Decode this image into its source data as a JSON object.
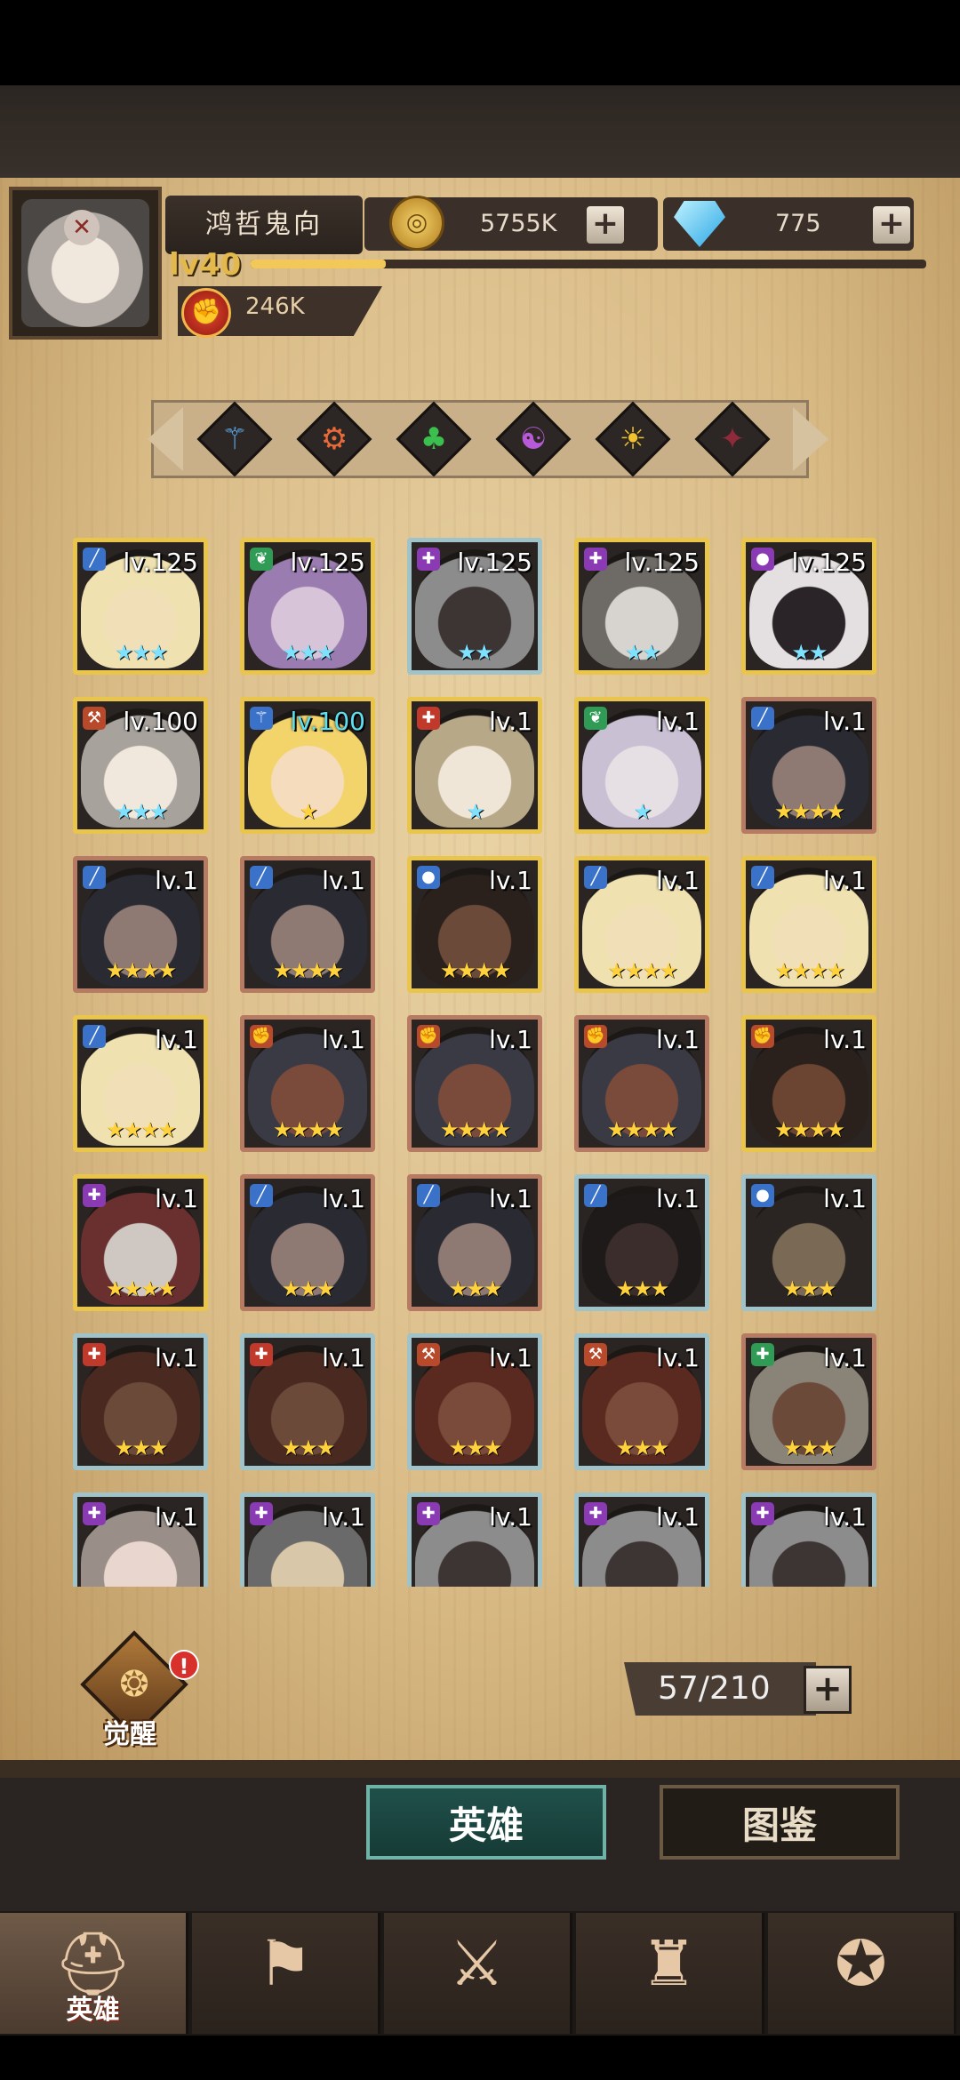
{
  "player": {
    "name": "鸿哲鬼向",
    "level_label": "lv40",
    "xp_fraction": 0.2,
    "power": "246K"
  },
  "currency": {
    "gold": "5755K",
    "gems": "775",
    "plus_symbol": "+"
  },
  "filters": [
    {
      "icon": "staff-class-icon",
      "glyph": "⚚",
      "color": "#5aa7e6"
    },
    {
      "icon": "gear-class-icon",
      "glyph": "⚙",
      "color": "#e86a3a"
    },
    {
      "icon": "clover-class-icon",
      "glyph": "♣",
      "color": "#3bbf4e"
    },
    {
      "icon": "orb-class-icon",
      "glyph": "☯",
      "color": "#b75ad8"
    },
    {
      "icon": "sun-class-icon",
      "glyph": "☀",
      "color": "#f1c12f"
    },
    {
      "icon": "demon-class-icon",
      "glyph": "✦",
      "color": "#8f2a3a"
    }
  ],
  "heroes": [
    {
      "level": "lv.125",
      "stars": "★★★",
      "star_color": "blue",
      "frame": "gold",
      "class": "blade",
      "class_color": "#3a72c9",
      "skin": "#f1dfb8",
      "hair": "#efe2b0"
    },
    {
      "level": "lv.125",
      "stars": "★★★",
      "star_color": "blue",
      "frame": "gold",
      "class": "herb",
      "class_color": "#2f9b55",
      "skin": "#d8c4d8",
      "hair": "#9a7cb0"
    },
    {
      "level": "lv.125",
      "stars": "★★",
      "star_color": "blue",
      "frame": "blue",
      "class": "holy",
      "class_color": "#8a3ab3",
      "skin": "#3c3533",
      "hair": "#8d8c8d"
    },
    {
      "level": "lv.125",
      "stars": "★★",
      "star_color": "blue",
      "frame": "gold",
      "class": "holy",
      "class_color": "#8a3ab3",
      "skin": "#d7d3cf",
      "hair": "#6e6a66"
    },
    {
      "level": "lv.125",
      "stars": "★★",
      "star_color": "blue",
      "frame": "gold",
      "class": "orb",
      "class_color": "#8a3ab3",
      "skin": "#2a2327",
      "hair": "#e4dfe0"
    },
    {
      "level": "lv.100",
      "stars": "★★★",
      "star_color": "blue",
      "frame": "gold",
      "class": "axe",
      "class_color": "#b84a2b",
      "skin": "#f0e7dd",
      "hair": "#a8a29c"
    },
    {
      "level": "lv.100",
      "level_color": "cyan",
      "stars": "★",
      "star_color": "gold",
      "frame": "gold",
      "class": "staff",
      "class_color": "#3a72c9",
      "skin": "#f4dcbc",
      "hair": "#f2d46a"
    },
    {
      "level": "lv.1",
      "stars": "★",
      "star_color": "blue",
      "frame": "gold",
      "class": "heal",
      "class_color": "#c0392b",
      "skin": "#efe6d8",
      "hair": "#b7a888"
    },
    {
      "level": "lv.1",
      "stars": "★",
      "star_color": "blue",
      "frame": "gold",
      "class": "herb",
      "class_color": "#2f9b55",
      "skin": "#e6e0e4",
      "hair": "#c9c0d4"
    },
    {
      "level": "lv.1",
      "stars": "★★★★",
      "star_color": "gold",
      "frame": "red",
      "class": "blade",
      "class_color": "#3a72c9",
      "skin": "#8e7a72",
      "hair": "#2a2a33"
    },
    {
      "level": "lv.1",
      "stars": "★★★★",
      "star_color": "gold",
      "frame": "red",
      "class": "blade",
      "class_color": "#3a72c9",
      "skin": "#8e7a72",
      "hair": "#2a2a33"
    },
    {
      "level": "lv.1",
      "stars": "★★★★",
      "star_color": "gold",
      "frame": "red",
      "class": "blade",
      "class_color": "#3a72c9",
      "skin": "#8e7a72",
      "hair": "#2a2a33"
    },
    {
      "level": "lv.1",
      "stars": "★★★★",
      "star_color": "gold",
      "frame": "gold",
      "class": "orb",
      "class_color": "#3a72c9",
      "skin": "#6b4a3a",
      "hair": "#2a211c"
    },
    {
      "level": "lv.1",
      "stars": "★★★★",
      "star_color": "gold",
      "frame": "gold",
      "class": "blade",
      "class_color": "#3a72c9",
      "skin": "#f1dfb8",
      "hair": "#efe2b0"
    },
    {
      "level": "lv.1",
      "stars": "★★★★",
      "star_color": "gold",
      "frame": "gold",
      "class": "blade",
      "class_color": "#3a72c9",
      "skin": "#f1dfb8",
      "hair": "#efe2b0"
    },
    {
      "level": "lv.1",
      "stars": "★★★★",
      "star_color": "gold",
      "frame": "gold",
      "class": "blade",
      "class_color": "#3a72c9",
      "skin": "#f1dfb8",
      "hair": "#efe2b0"
    },
    {
      "level": "lv.1",
      "stars": "★★★★",
      "star_color": "gold",
      "frame": "red",
      "class": "fist",
      "class_color": "#b84a2b",
      "skin": "#7a4a3a",
      "hair": "#3a3a44"
    },
    {
      "level": "lv.1",
      "stars": "★★★★",
      "star_color": "gold",
      "frame": "red",
      "class": "fist",
      "class_color": "#b84a2b",
      "skin": "#7a4a3a",
      "hair": "#3a3a44"
    },
    {
      "level": "lv.1",
      "stars": "★★★★",
      "star_color": "gold",
      "frame": "red",
      "class": "fist",
      "class_color": "#b84a2b",
      "skin": "#7a4a3a",
      "hair": "#3a3a44"
    },
    {
      "level": "lv.1",
      "stars": "★★★★",
      "star_color": "gold",
      "frame": "gold",
      "class": "fist",
      "class_color": "#b84a2b",
      "skin": "#6b4532",
      "hair": "#2a211c"
    },
    {
      "level": "lv.1",
      "stars": "★★★★",
      "star_color": "gold",
      "frame": "gold",
      "class": "holy",
      "class_color": "#8a3ab3",
      "skin": "#cfc8c2",
      "hair": "#6a3030"
    },
    {
      "level": "lv.1",
      "stars": "★★★",
      "star_color": "gold",
      "frame": "red",
      "class": "blade",
      "class_color": "#3a72c9",
      "skin": "#8e7a72",
      "hair": "#2a2a33"
    },
    {
      "level": "lv.1",
      "stars": "★★★",
      "star_color": "gold",
      "frame": "red",
      "class": "blade",
      "class_color": "#3a72c9",
      "skin": "#8e7a72",
      "hair": "#2a2a33"
    },
    {
      "level": "lv.1",
      "stars": "★★★",
      "star_color": "gold",
      "frame": "blue",
      "class": "blade",
      "class_color": "#3a72c9",
      "skin": "#3a2d2b",
      "hair": "#1e1a19"
    },
    {
      "level": "lv.1",
      "stars": "★★★",
      "star_color": "gold",
      "frame": "blue",
      "class": "orb",
      "class_color": "#3a72c9",
      "skin": "#7a6a55",
      "hair": "#2a2522"
    },
    {
      "level": "lv.1",
      "stars": "★★★",
      "star_color": "gold",
      "frame": "blue",
      "class": "heal",
      "class_color": "#c0392b",
      "skin": "#6b4a3a",
      "hair": "#4a2a20"
    },
    {
      "level": "lv.1",
      "stars": "★★★",
      "star_color": "gold",
      "frame": "blue",
      "class": "heal",
      "class_color": "#c0392b",
      "skin": "#6b4a3a",
      "hair": "#4a2a20"
    },
    {
      "level": "lv.1",
      "stars": "★★★",
      "star_color": "gold",
      "frame": "blue",
      "class": "axe",
      "class_color": "#b84a2b",
      "skin": "#7a4a3a",
      "hair": "#5a2a20"
    },
    {
      "level": "lv.1",
      "stars": "★★★",
      "star_color": "gold",
      "frame": "blue",
      "class": "axe",
      "class_color": "#b84a2b",
      "skin": "#7a4a3a",
      "hair": "#5a2a20"
    },
    {
      "level": "lv.1",
      "stars": "★★★",
      "star_color": "gold",
      "frame": "red",
      "class": "heal",
      "class_color": "#2f9b55",
      "skin": "#6b4a3a",
      "hair": "#8a8478"
    },
    {
      "level": "lv.1",
      "stars": "",
      "star_color": "gold",
      "frame": "blue",
      "class": "holy",
      "class_color": "#8a3ab3",
      "skin": "#e8d6cf",
      "hair": "#9a8f88"
    },
    {
      "level": "lv.1",
      "stars": "",
      "star_color": "gold",
      "frame": "blue",
      "class": "holy",
      "class_color": "#8a3ab3",
      "skin": "#d8c7a8",
      "hair": "#6a6a6a"
    },
    {
      "level": "lv.1",
      "stars": "",
      "star_color": "gold",
      "frame": "blue",
      "class": "holy",
      "class_color": "#8a3ab3",
      "skin": "#3c3533",
      "hair": "#8d8c8d"
    },
    {
      "level": "lv.1",
      "stars": "",
      "star_color": "gold",
      "frame": "blue",
      "class": "holy",
      "class_color": "#8a3ab3",
      "skin": "#3c3533",
      "hair": "#8d8c8d"
    },
    {
      "level": "lv.1",
      "stars": "",
      "star_color": "gold",
      "frame": "blue",
      "class": "holy",
      "class_color": "#8a3ab3",
      "skin": "#3c3533",
      "hair": "#8d8c8d"
    }
  ],
  "awaken": {
    "label": "觉醒",
    "badge": "!"
  },
  "capacity": {
    "text": "57/210",
    "plus": "+"
  },
  "subtabs": {
    "heroes": "英雄",
    "codex": "图鉴"
  },
  "nav": [
    {
      "icon": "helmet-icon",
      "glyph": "⛑",
      "label": "英雄",
      "active": true
    },
    {
      "icon": "flag-wheel-icon",
      "glyph": "⚑",
      "label": "",
      "active": false
    },
    {
      "icon": "crossed-swords-icon",
      "glyph": "⚔",
      "label": "",
      "active": false
    },
    {
      "icon": "castle-icon",
      "glyph": "♜",
      "label": "",
      "active": false
    },
    {
      "icon": "handshake-emblem-icon",
      "glyph": "✪",
      "label": "",
      "active": false
    }
  ]
}
